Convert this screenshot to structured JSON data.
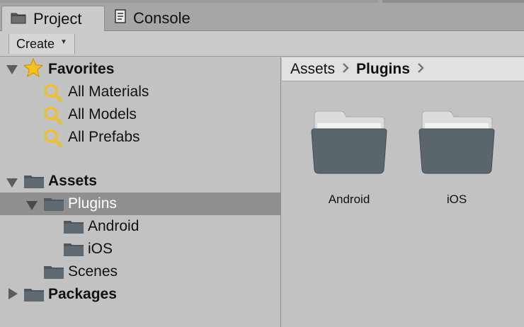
{
  "tabs": {
    "project": "Project",
    "console": "Console"
  },
  "toolbar": {
    "create_label": "Create"
  },
  "tree": {
    "favorites": {
      "label": "Favorites",
      "items": [
        "All Materials",
        "All Models",
        "All Prefabs"
      ]
    },
    "assets": {
      "label": "Assets",
      "plugins": {
        "label": "Plugins",
        "children": [
          "Android",
          "iOS"
        ]
      },
      "scenes": "Scenes"
    },
    "packages": "Packages"
  },
  "breadcrumb": [
    "Assets",
    "Plugins"
  ],
  "grid": {
    "items": [
      "Android",
      "iOS"
    ]
  },
  "icons": {
    "project_tab": "folder-tab-icon",
    "console_tab": "console-icon",
    "favorites": "star-icon",
    "search": "magnifier-icon",
    "folder": "folder-icon"
  },
  "colors": {
    "selected_row": "#8f8f8f",
    "folder": "#58646b",
    "star": "#f6c21a",
    "search_lens": "#f2c01e"
  }
}
